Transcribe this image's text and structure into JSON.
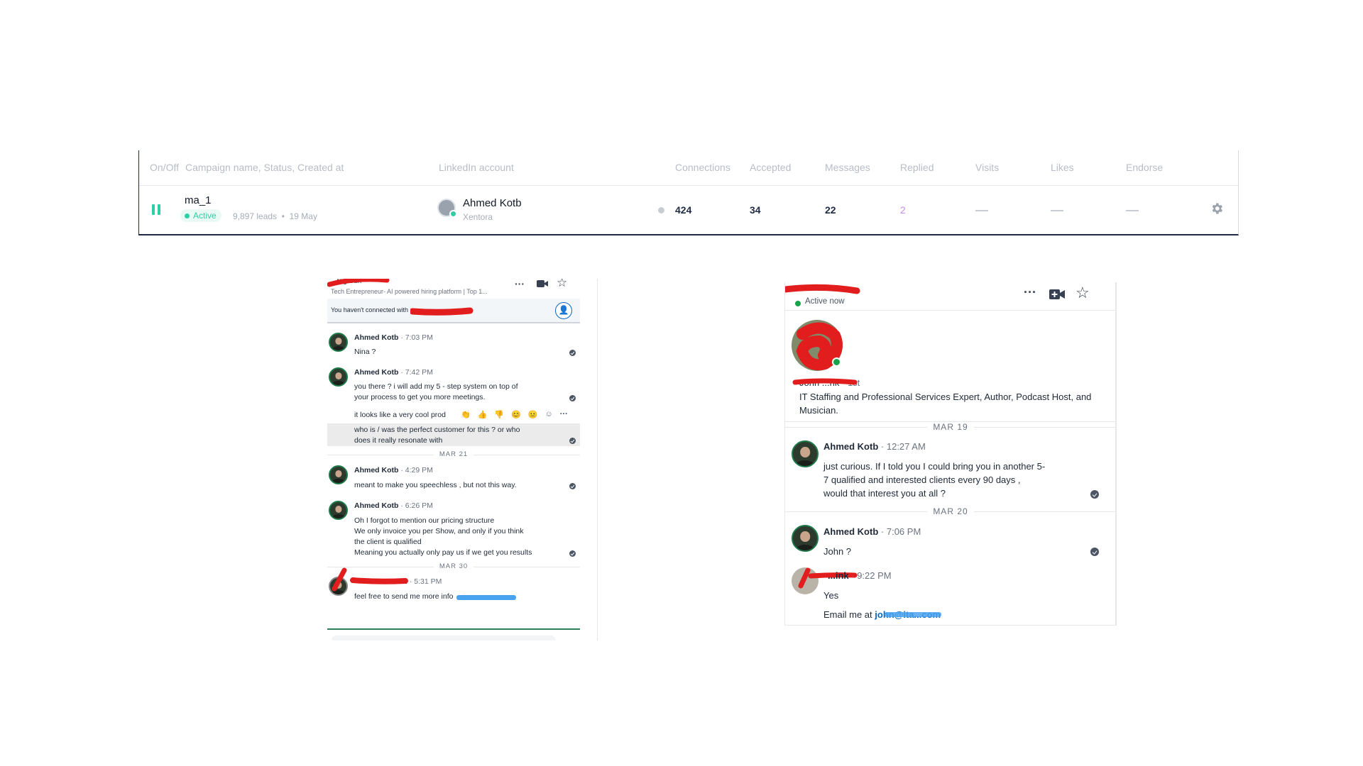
{
  "campaign_table": {
    "headers": {
      "on_off": "On/Off",
      "campaign": "Campaign name, Status, Created at",
      "linkedin_account": "LinkedIn account",
      "connections": "Connections",
      "accepted": "Accepted",
      "messages": "Messages",
      "replied": "Replied",
      "visits": "Visits",
      "likes": "Likes",
      "endorse": "Endorse"
    },
    "row": {
      "name": "ma_1",
      "status": "Active",
      "leads": "9,897 leads",
      "separator": "•",
      "created": "19 May",
      "account_name": "Ahmed Kotb",
      "account_company": "Xentora",
      "connections": "424",
      "accepted": "34",
      "messages": "22",
      "replied": "2",
      "visits": "—",
      "likes": "—",
      "endorse": "—"
    },
    "colors": {
      "active": "#2ecfa6",
      "replied": "#c58cf0",
      "border": "#1f2a44"
    }
  },
  "chat_left": {
    "header_name": "...rag Sun",
    "subtitle": "Tech Entrepreneur- AI powered hiring platform | Top 1...",
    "connect_notice": "You haven't connected with",
    "icons": [
      "more-icon",
      "video-icon",
      "star-icon",
      "add-person-icon"
    ],
    "messages": [
      {
        "sender": "Ahmed Kotb",
        "time": "7:03 PM",
        "lines": [
          "Nina ?"
        ]
      },
      {
        "sender": "Ahmed Kotb",
        "time": "7:42 PM",
        "lines": [
          "you there ? i will add my 5 - step system on top of",
          "your process to get you more meetings."
        ]
      },
      {
        "sender": "",
        "time": "",
        "lines": [
          "it looks like a very cool prod"
        ]
      },
      {
        "sender": "",
        "time": "",
        "lines": [
          "who is / was the perfect customer for this ? or who",
          "does it really resonate with"
        ]
      },
      {
        "sender": "Ahmed Kotb",
        "time": "4:29 PM",
        "lines": [
          "meant to make you speechless , but not this way."
        ]
      },
      {
        "sender": "Ahmed Kotb",
        "time": "6:26 PM",
        "lines": [
          "Oh I forgot to mention our pricing structure",
          "We only invoice you per Show, and only if you think",
          "the client is qualified",
          "Meaning you actually only pay us if we get you results"
        ]
      },
      {
        "sender": "i",
        "time": "5:31 PM",
        "lines": [
          "feel free to send me more info"
        ]
      }
    ],
    "dates": [
      "MAR 21",
      "MAR 30"
    ],
    "reactions": [
      "👏",
      "👍",
      "👎",
      "😊",
      "😐"
    ]
  },
  "chat_right": {
    "active_status": "Active now",
    "profile_name": "John ...nk",
    "profile_degree": "· 1st",
    "profile_headline": "IT Staffing and Professional Services Expert, Author, Podcast Host, and Musician.",
    "icons": [
      "more-icon",
      "video-icon",
      "star-icon"
    ],
    "dates": [
      "MAR 19",
      "MAR 20"
    ],
    "messages": [
      {
        "sender": "Ahmed Kotb",
        "time": "12:27 AM",
        "lines": [
          "just curious. If I told you I could bring you in another 5-",
          "7 qualified and interested clients every 90 days ,",
          "would that interest you at all ?"
        ]
      },
      {
        "sender": "Ahmed Kotb",
        "time": "7:06 PM",
        "lines": [
          "John ?"
        ]
      },
      {
        "sender": "...ink",
        "time": "9:22 PM",
        "lines": [
          "Yes",
          "Email me at"
        ]
      }
    ],
    "email_link": "john@ita...com"
  }
}
